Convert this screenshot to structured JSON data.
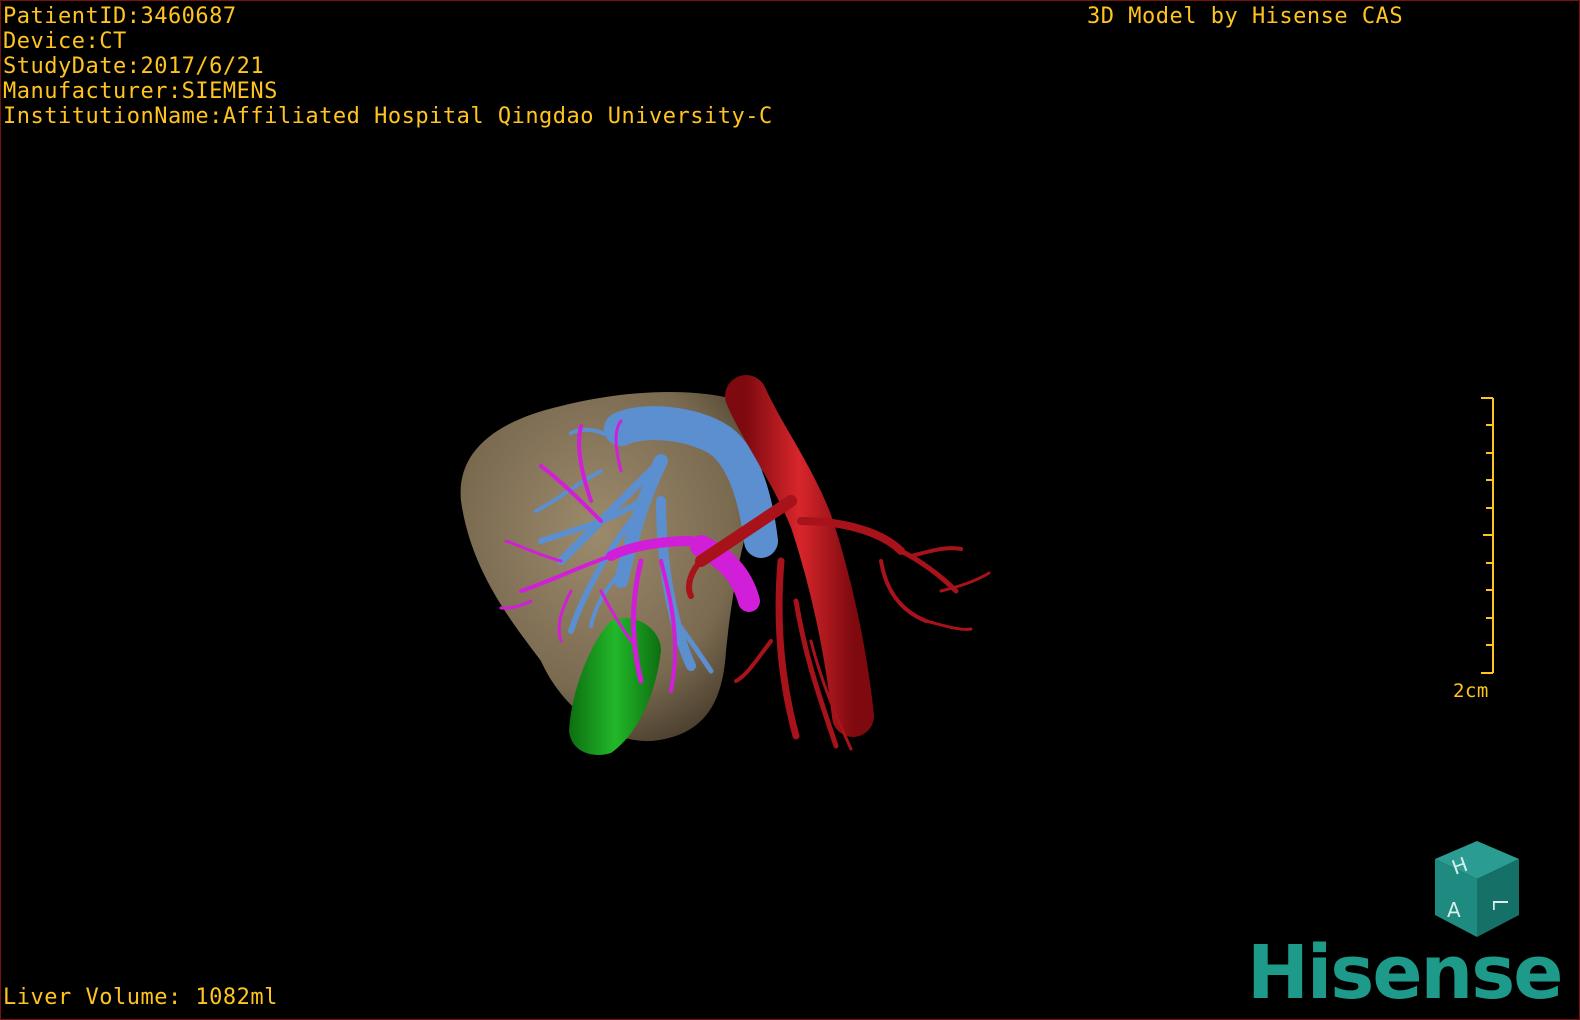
{
  "header": {
    "patient_id": "PatientID:3460687",
    "device": "Device:CT",
    "study_date": "StudyDate:2017/6/21",
    "manufacturer": "Manufacturer:SIEMENS",
    "institution": "InstitutionName:Affiliated Hospital Qingdao University-C",
    "credit": "3D Model by Hisense CAS"
  },
  "footer": {
    "liver_volume": "Liver Volume: 1082ml"
  },
  "scale": {
    "label": "2cm"
  },
  "orientation_cube": {
    "faces": [
      "H",
      "A",
      "L"
    ]
  },
  "brand": {
    "name": "Hisense"
  },
  "colors": {
    "overlay_text": "#ffc41f",
    "liver": "#8a7a5f",
    "artery": "#b3121a",
    "portal_vein": "#5b8fd0",
    "hepatic_vein": "#d11ed8",
    "gallbladder_or_duct": "#17a01c",
    "brand": "#1e9a8a"
  },
  "structures": [
    "liver",
    "artery",
    "portal-vein",
    "hepatic-vein",
    "gallbladder"
  ]
}
